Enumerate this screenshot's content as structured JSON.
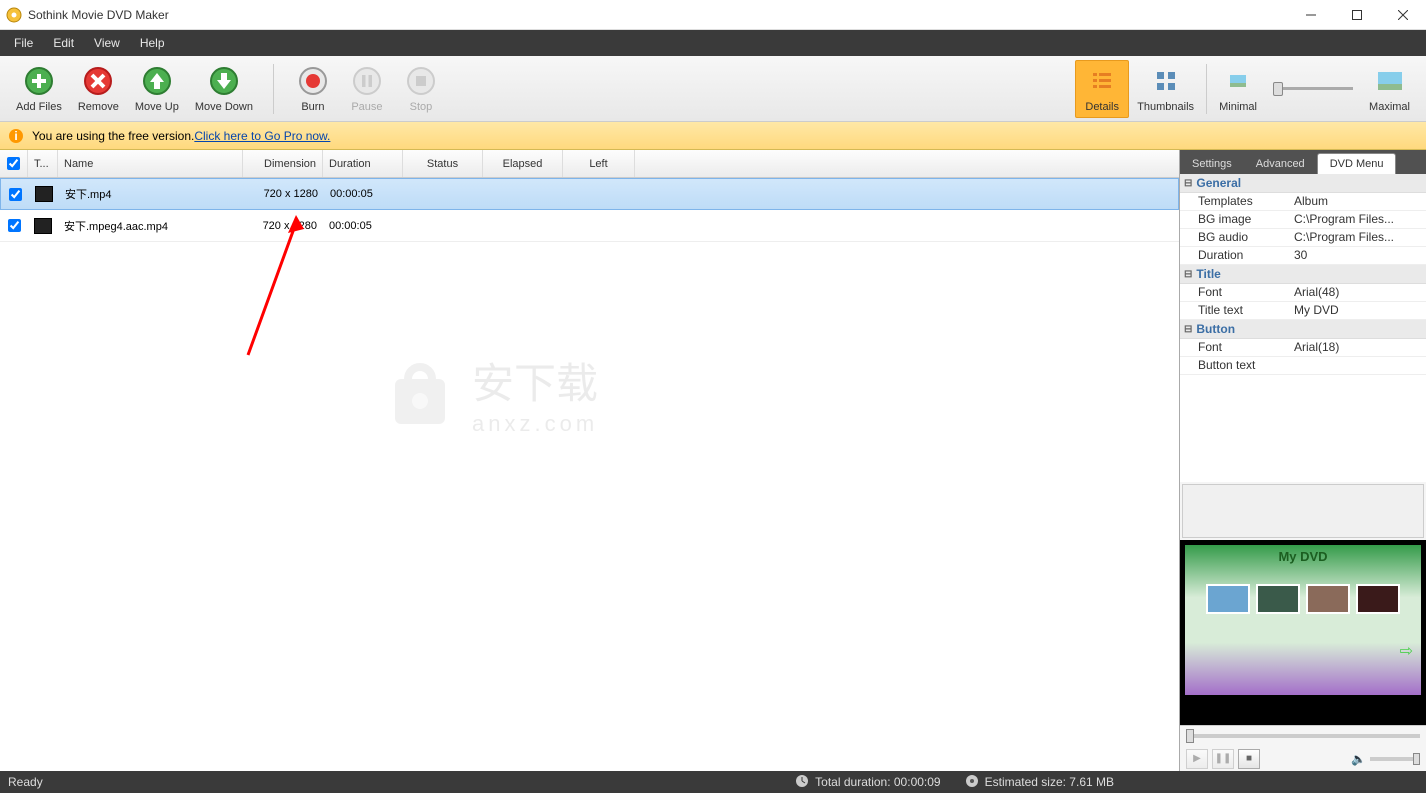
{
  "window": {
    "title": "Sothink Movie DVD Maker"
  },
  "menu": {
    "file": "File",
    "edit": "Edit",
    "view": "View",
    "help": "Help"
  },
  "toolbar": {
    "add_files": "Add Files",
    "remove": "Remove",
    "move_up": "Move Up",
    "move_down": "Move Down",
    "burn": "Burn",
    "pause": "Pause",
    "stop": "Stop",
    "details": "Details",
    "thumbnails": "Thumbnails",
    "minimal": "Minimal",
    "maximal": "Maximal"
  },
  "infobar": {
    "text": "You are using the free version. ",
    "link": "Click here to Go Pro now."
  },
  "columns": {
    "type": "T...",
    "name": "Name",
    "dimension": "Dimension",
    "duration": "Duration",
    "status": "Status",
    "elapsed": "Elapsed",
    "left": "Left"
  },
  "files": [
    {
      "checked": true,
      "name": "安下.mp4",
      "dimension": "720 x 1280",
      "duration": "00:00:05",
      "selected": true
    },
    {
      "checked": true,
      "name": "安下.mpeg4.aac.mp4",
      "dimension": "720 x 1280",
      "duration": "00:00:05",
      "selected": false
    }
  ],
  "tabs": {
    "settings": "Settings",
    "advanced": "Advanced",
    "dvd_menu": "DVD Menu"
  },
  "props": {
    "general": {
      "header": "General",
      "templates": {
        "k": "Templates",
        "v": "Album"
      },
      "bg_image": {
        "k": "BG image",
        "v": "C:\\Program Files..."
      },
      "bg_audio": {
        "k": "BG audio",
        "v": "C:\\Program Files..."
      },
      "duration": {
        "k": "Duration",
        "v": "30"
      }
    },
    "title": {
      "header": "Title",
      "font": {
        "k": "Font",
        "v": "Arial(48)"
      },
      "title_text": {
        "k": "Title text",
        "v": "My DVD"
      }
    },
    "button": {
      "header": "Button",
      "font": {
        "k": "Font",
        "v": "Arial(18)"
      },
      "button_text": {
        "k": "Button text",
        "v": ""
      }
    }
  },
  "preview": {
    "title": "My DVD"
  },
  "status": {
    "ready": "Ready",
    "total_duration": "Total duration: 00:00:09",
    "estimated_size": "Estimated size: 7.61 MB"
  },
  "watermark": {
    "text": "安下载",
    "sub": "anxz.com"
  }
}
